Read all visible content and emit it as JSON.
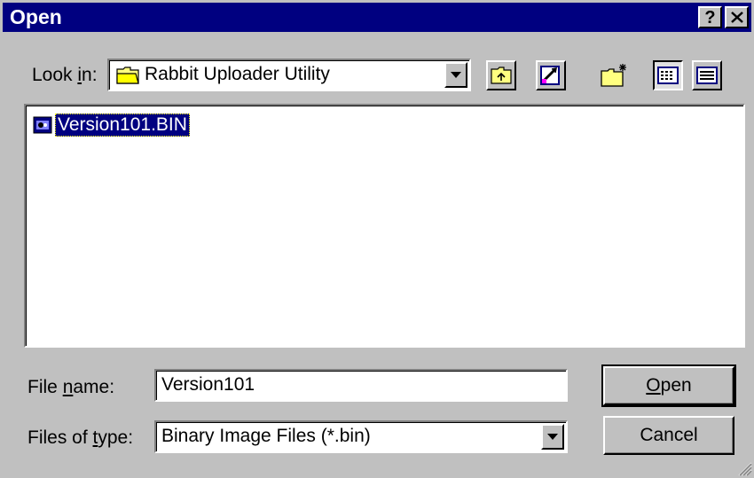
{
  "window": {
    "title": "Open",
    "help_label": "?",
    "close_label": "✕"
  },
  "look_in": {
    "label_prefix": "Look ",
    "label_accel": "i",
    "label_suffix": "n:",
    "value": "Rabbit Uploader Utility"
  },
  "toolbar": {
    "buttons": [
      "up-one-level",
      "create-shortcut",
      "new-folder",
      "list-view",
      "details-view"
    ],
    "active_view": "list-view"
  },
  "files": [
    {
      "name": "Version101.BIN",
      "selected": true,
      "icon": "binary-file-icon"
    }
  ],
  "file_name": {
    "label_prefix": "File ",
    "label_accel": "n",
    "label_suffix": "ame:",
    "value": "Version101"
  },
  "file_type": {
    "label_prefix": "Files of ",
    "label_accel": "t",
    "label_suffix": "ype:",
    "value": "Binary Image Files (*.bin)"
  },
  "buttons": {
    "open_accel": "O",
    "open_rest": "pen",
    "cancel": "Cancel"
  },
  "colors": {
    "titlebar": "#000080",
    "face": "#c0c0c0",
    "selection": "#000080"
  }
}
